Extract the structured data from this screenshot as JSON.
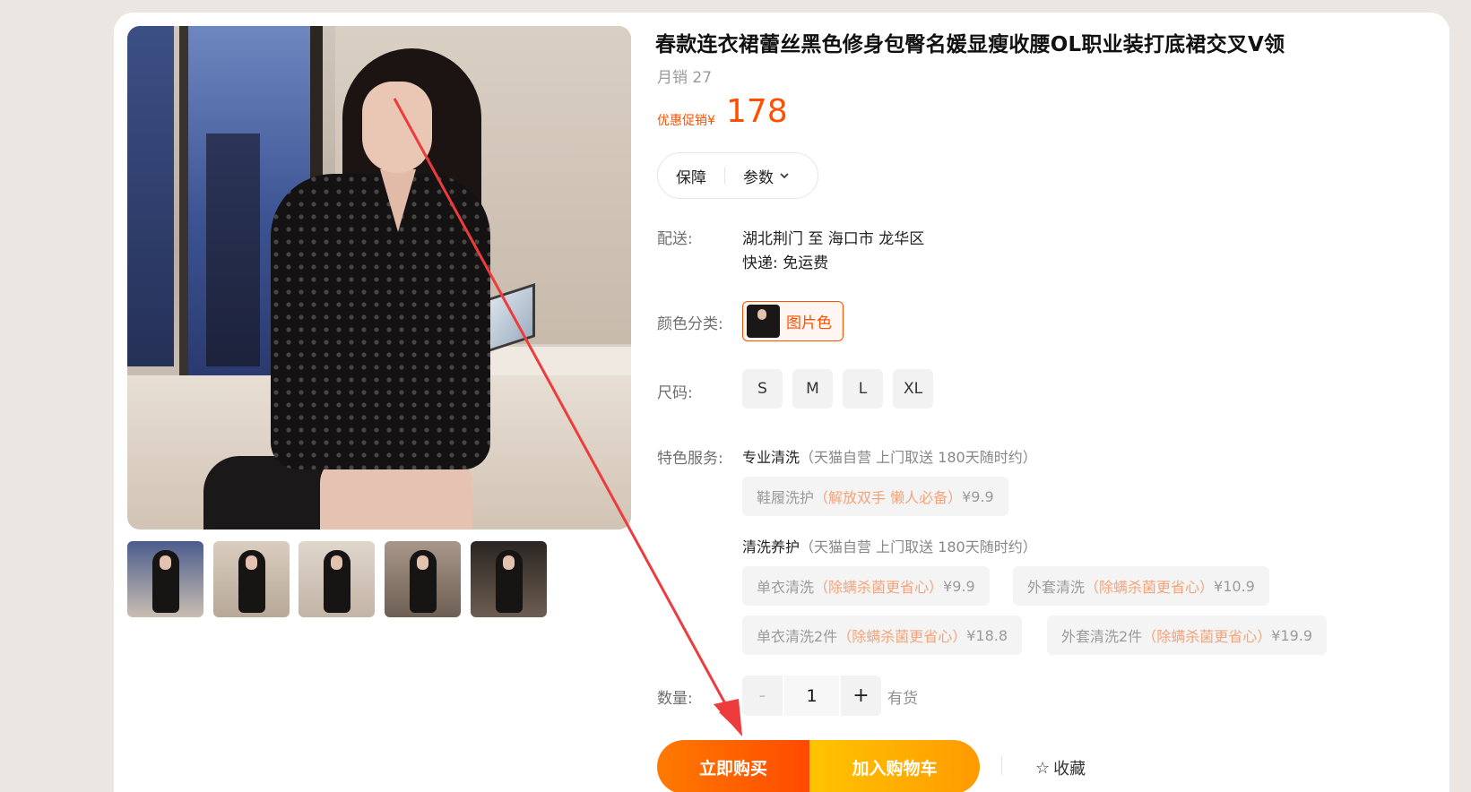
{
  "product": {
    "title": "春款连衣裙蕾丝黑色修身包臀名媛显瘦收腰OL职业装打底裙交叉V领",
    "monthly_sales": "月销 27",
    "promo_label": "优惠促销¥",
    "price": "178"
  },
  "tabs": {
    "guarantee": "保障",
    "params": "参数"
  },
  "shipping": {
    "label": "配送:",
    "route": "湖北荆门 至 海口市 龙华区",
    "fee": "快递: 免运费"
  },
  "color": {
    "label": "颜色分类:",
    "selected": "图片色"
  },
  "size": {
    "label": "尺码:",
    "options": [
      "S",
      "M",
      "L",
      "XL"
    ]
  },
  "services": {
    "label": "特色服务:",
    "groups": [
      {
        "title": "专业清洗",
        "subtitle": "（天猫自营 上门取送 180天随时约）",
        "options": [
          {
            "name": "鞋履洗护",
            "tag": "（解放双手 懒人必备）",
            "price": "¥9.9"
          }
        ]
      },
      {
        "title": "清洗养护",
        "subtitle": "（天猫自营 上门取送 180天随时约）",
        "options": [
          {
            "name": "单衣清洗",
            "tag": "（除螨杀菌更省心）",
            "price": "¥9.9"
          },
          {
            "name": "外套清洗",
            "tag": "（除螨杀菌更省心）",
            "price": "¥10.9"
          },
          {
            "name": "单衣清洗2件",
            "tag": "（除螨杀菌更省心）",
            "price": "¥18.8"
          },
          {
            "name": "外套清洗2件",
            "tag": "（除螨杀菌更省心）",
            "price": "¥19.9"
          }
        ]
      }
    ]
  },
  "quantity": {
    "label": "数量:",
    "minus": "-",
    "value": "1",
    "plus": "+",
    "stock": "有货"
  },
  "actions": {
    "buy_now": "立即购买",
    "add_cart": "加入购物车",
    "favorite": "收藏"
  },
  "colors": {
    "accent": "#ff5000",
    "annotation_arrow": "#ee3b3b"
  }
}
